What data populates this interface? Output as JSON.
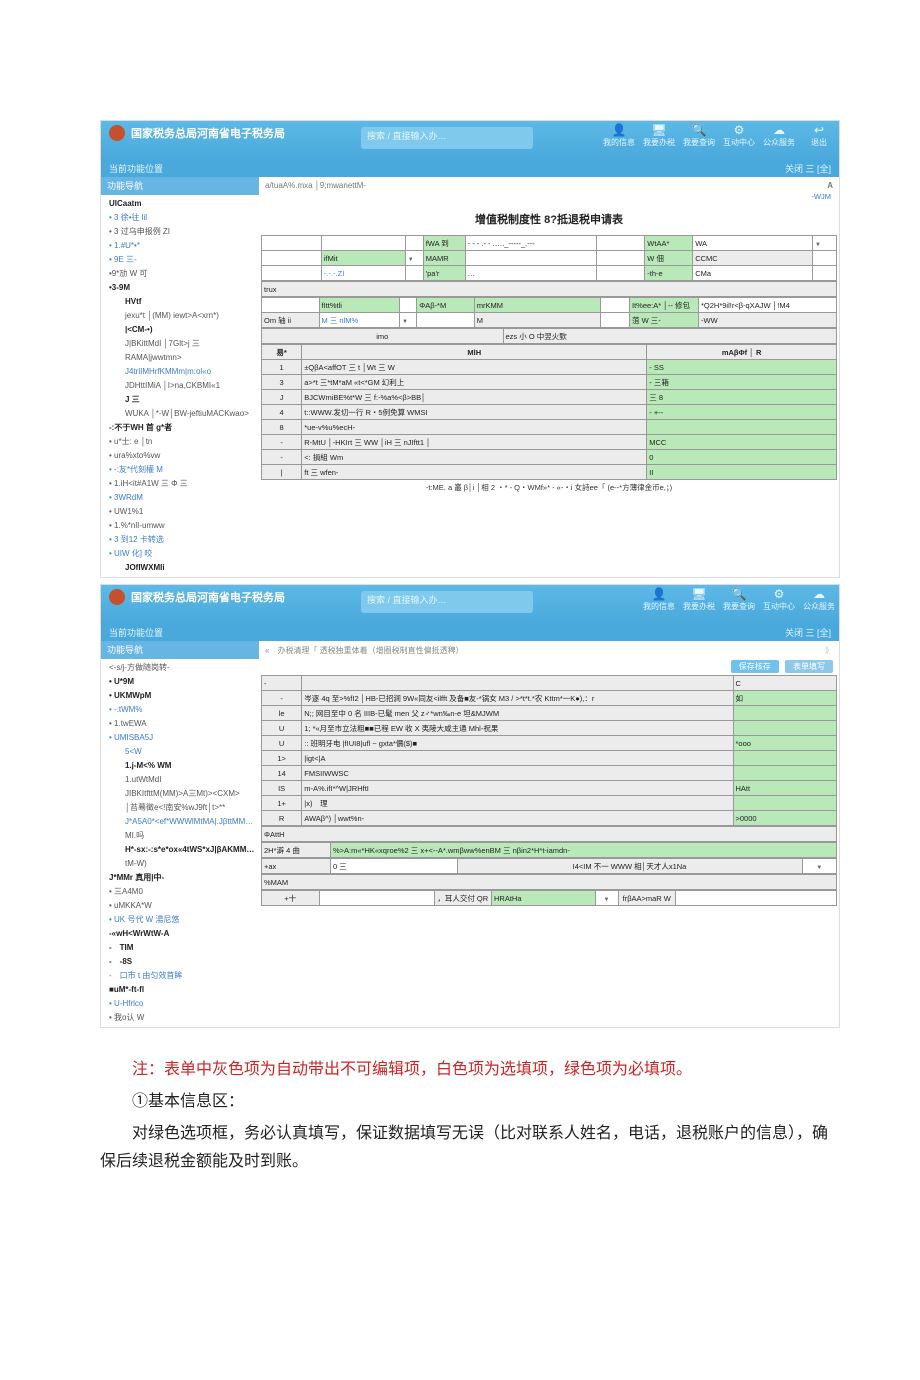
{
  "doc": {
    "note_red": "注：表单中灰色项为自动带出不可编辑项，白色项为选填项，绿色项为必填项。",
    "section_heading": "①基本信息区：",
    "para1": "对绿色选项框，务必认真填写，保证数据填写无误（比对联系人姓名，电话，退税账户的信息），确保后续退税金额能及时到账。"
  },
  "app1": {
    "title": "国家税务总局河南省电子税务局",
    "search_placeholder": "搜索 / 直接输入办…",
    "top_icons": [
      {
        "label": "我的信息",
        "glyph": "👤"
      },
      {
        "label": "我要办税",
        "glyph": "🖥"
      },
      {
        "label": "我要查询",
        "glyph": "🔍"
      },
      {
        "label": "互动中心",
        "glyph": "⚙"
      },
      {
        "label": "公众服务",
        "glyph": "☁"
      },
      {
        "label": "退出",
        "glyph": "↩"
      }
    ],
    "strip_left": "当前功能位置",
    "strip_right": "关闭 三 [全]",
    "sidebar_head": "功能导航",
    "sidebar": [
      {
        "t": "UlCaatm",
        "cls": "bold"
      },
      {
        "t": "• 3 徐•往 lil",
        "cls": "blue"
      },
      {
        "t": "• 3 过乌申报例 ZI"
      },
      {
        "t": "• 1.#U*•*",
        "cls": "blue"
      },
      {
        "t": "• 9E 三-",
        "cls": "blue"
      },
      {
        "t": "•9*劢 W 可"
      },
      {
        "t": "•3-9M",
        "cls": "bold"
      },
      {
        "t": "　　HVtf",
        "cls": "bold"
      },
      {
        "t": "　　jexu*t │(MM) iewt>A<xrn*)"
      },
      {
        "t": "　　|<CM-•)",
        "cls": "bold"
      },
      {
        "t": "　　J|BKittMdI │7Glt>j 三"
      },
      {
        "t": "　　RAMA|jwwtmn>"
      },
      {
        "t": "　　J4trlIMHrfKMMm|m:ol«o",
        "cls": "blue"
      },
      {
        "t": "　　JDHttIMiA │I>na,CKBMI«1"
      },
      {
        "t": "　　J 三",
        "cls": "bold"
      },
      {
        "t": "　　WUKA │*-W│BW-jeftiuMACKwao>"
      },
      {
        "t": "-:不于WH 首 g*者",
        "cls": "bold"
      },
      {
        "t": "• u*士: e │tn"
      },
      {
        "t": "• ura%xto%vw"
      },
      {
        "t": "• -:友*代刻權 M",
        "cls": "blue"
      },
      {
        "t": "• 1.iH<it#A1W 三 Φ 三"
      },
      {
        "t": "• 3WRdM",
        "cls": "blue"
      },
      {
        "t": "• UW1%1"
      },
      {
        "t": "• 1.%*nlI-umww"
      },
      {
        "t": "• 3 到12 卡转选",
        "cls": "blue"
      },
      {
        "t": "",
        "cls": ""
      },
      {
        "t": "• UIW 化] 咬",
        "cls": "blue"
      },
      {
        "t": "　　JOfIWXMIi",
        "cls": "bold"
      }
    ],
    "breadcrumb_left": "a/tuaA%.mxa │9;mwanettM-",
    "breadcrumb_right_a": "A",
    "breadcrumb_blue": "-WJM",
    "form_title": "增值税制度性 8?抵退税申请表",
    "grid_top": {
      "r1": [
        "",
        "",
        "",
        "fWA 到",
        "- - - .- - .…._-----_.---",
        "",
        "WtAA*",
        "WA",
        "▼"
      ],
      "r2": [
        "",
        "ifMit",
        "▼",
        "MAMR",
        "",
        "",
        "W 佃",
        "CCMC",
        ""
      ],
      "r3": [
        "",
        "-.-.-.ZI",
        "",
        "'pa'r",
        "…",
        "",
        "-th-e",
        "CMa",
        ""
      ]
    },
    "trux": "trux",
    "grid_mid": {
      "r1": [
        "",
        "fItt%tli",
        "",
        "ΦAβ-*M",
        "mrKMM",
        "",
        "It%ee:A* │-‑ 修包",
        "*Q2H*9il!r<β-qXAJW │!M4"
      ],
      "r2": [
        "Om 轴 ii",
        "M 三 nlM%",
        "▼",
        "",
        "M",
        "",
        "菹 W 三-",
        "-WW"
      ]
    },
    "imo": "imo",
    "imo_right": "ezs 小 O 中翌火歅",
    "cols_header": [
      "易*",
      "MlH",
      "mAβΦf │ R"
    ],
    "rows": [
      [
        "1",
        "±QβA<affOT 三 t │Wt 三 W",
        "- SS"
      ],
      [
        "3",
        "a>*t 三*tM*aM «t<*GM 幻利上",
        "- 三箱"
      ],
      [
        "J",
        "BJCWmiBE%t*W 三 f:-%a%<β>BB│",
        "三 8"
      ],
      [
        "4",
        "t::WWW.发切一行 R・5例免算 WMSI",
        "- +--"
      ],
      [
        "8",
        "*ue-v%u%ecH-",
        ""
      ],
      [
        "-",
        "R-MtU │-HKIrt 三 WW │iH 三 nJIftt1 │",
        "MCC"
      ],
      [
        "-",
        "<: 損組 Wm",
        "0"
      ],
      [
        "|",
        "ft 三 wfen-",
        "II"
      ]
    ],
    "foot_note": "-t:ME. a 叢 β│i │相 2 ・* - Q・WMf»* - «-・i 女詩ee「 (e--*方薄律金币e,；)"
  },
  "app2": {
    "title": "国家税务总局河南省电子税务局",
    "search_placeholder": "搜索 / 直接输入办…",
    "top_icons": [
      {
        "label": "我的信息",
        "glyph": "👤"
      },
      {
        "label": "我要办税",
        "glyph": "🖥"
      },
      {
        "label": "我要查询",
        "glyph": "🔍"
      },
      {
        "label": "互动中心",
        "glyph": "⚙"
      },
      {
        "label": "公众服务",
        "glyph": "☁"
      }
    ],
    "strip_left": "当前功能位置",
    "strip_right": "关闭 三 [全]",
    "sidebar_head": "功能导航",
    "crumb": "办税清理「 透税独重体着（增圈税制直性偏抵透稗）",
    "sidebar": [
      {
        "t": "<-s/j-方做随岗转-"
      },
      {
        "t": "• U*9M",
        "cls": "bold"
      },
      {
        "t": "• UKMWpM",
        "cls": "bold"
      },
      {
        "t": "• -:tWM%",
        "cls": "blue"
      },
      {
        "t": "• 1.twEWA"
      },
      {
        "t": "• UMISBA5J",
        "cls": "blue"
      },
      {
        "t": "　　5<W",
        "cls": "blue"
      },
      {
        "t": "　　1.j-M<% WM",
        "cls": "bold"
      },
      {
        "t": "　　1.utWtMdI"
      },
      {
        "t": "　　JIBKItfttM(MM)>A三Mt)><CXM>"
      },
      {
        "t": "　　│苔蓦徵e<!南安%wJ9ft│t>**"
      },
      {
        "t": "　　J*A5A0*<ef*WWWlMtMA|.JβttMM(石",
        "cls": "blue"
      },
      {
        "t": "　　MI.吗"
      },
      {
        "t": "　　H*-sx:-:s*e*ox«4tWS*xJ|βAKMM|MW!",
        "cls": "bold"
      },
      {
        "t": "　　tM-W)"
      },
      {
        "t": "J*MMr 真用|中-",
        "cls": "bold"
      },
      {
        "t": "• 三A4M0"
      },
      {
        "t": "• uMKKA*W"
      },
      {
        "t": "• UK 号代 W 湯尼悠",
        "cls": "blue"
      },
      {
        "t": "-«wH<WrWtW-A",
        "cls": "bold"
      },
      {
        "t": "-　TIM",
        "cls": "bold"
      },
      {
        "t": "-　-8S",
        "cls": "bold"
      },
      {
        "t": "-　口市 t 由匀效苜眸",
        "cls": "blue"
      },
      {
        "t": "■uM*-ft-fl",
        "cls": "bold"
      },
      {
        "t": "• U-Hfrlco",
        "cls": "blue"
      },
      {
        "t": "• 我o认 W"
      }
    ],
    "toolbar": {
      "save": "保存核存",
      "print": "表单填写"
    },
    "rows_top_head": [
      "-",
      "C"
    ],
    "rows": [
      [
        "-",
        "岑逐 4q 至>%fI2 │HB-已招涧 9W«同友<ilfft 及备■友-*锅女 M3  /  >*t*t.*农 Kttm*一K●),：r",
        "如"
      ],
      [
        "le",
        "N;; 网目至中 0 名 IIIB-已髦 men 父 z♂*wn‰n-e 坦&MJWM",
        ""
      ],
      [
        "U",
        "1; *«月至市立法粗■■已程 EW 收 X 夷陵大咸主通 Mhl-祝果",
        ""
      ],
      [
        "U",
        ":: 班明牙电 |fIUI8|ufl ~ gxta*價($)■",
        "*ooo"
      ],
      [
        "1>",
        "|igt<|A",
        ""
      ],
      [
        "14",
        "FMSIIWWSC",
        ""
      ],
      [
        "IS",
        "m-A%.ifI*^W|JRHftI",
        "HAtt"
      ],
      [
        "1+",
        "|x)　理",
        ""
      ],
      [
        "R",
        "AWAβ^) │wwt%n-",
        ">0000"
      ]
    ],
    "section_bdatth": "ΦAttH",
    "row_2h": [
      "2H*澼 4 曲",
      "%>A:m«*HK«xqroe%2 三 x+<--A*.wmβww%enBM 三 nβin2*H*t-iamdn-"
    ],
    "row_ax": [
      "+ax",
      "0 三",
      "I4<IM 不一 WWW 相│天才人x1Na",
      "▼"
    ],
    "section_mam": "%MAM",
    "row_plus": {
      "left": "+十",
      "c1": "",
      "c2": "，耳人交付 QR",
      "c3": "HRAtHa",
      "c4": "▼",
      "c5": "frβAA>maR W",
      "c6": ""
    }
  }
}
